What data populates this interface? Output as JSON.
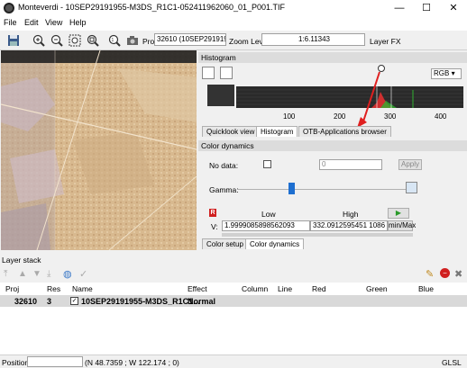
{
  "window": {
    "title": "Monteverdi - 10SEP29191955-M3DS_R1C1-052411962060_01_P001.TIF",
    "minimize": "—",
    "maximize": "☐",
    "close": "✕"
  },
  "menu": [
    "File",
    "Edit",
    "View",
    "Help"
  ],
  "toolbar": {
    "proj_label": "Proj",
    "proj_value": "32610 (10SEP291919",
    "zoom_label": "Zoom Level",
    "zoom_value": "1:6.11343",
    "layerfx_label": "Layer FX"
  },
  "histogram": {
    "title": "Histogram",
    "mode": "RGB",
    "ticks": [
      "100",
      "200",
      "300",
      "400"
    ],
    "colors": {
      "red": "#e03030",
      "green": "#30b030",
      "blue": "#3050e0"
    }
  },
  "right_tabs": [
    "Quicklook view",
    "Histogram",
    "OTB-Applications browser"
  ],
  "color_dynamics": {
    "title": "Color dynamics",
    "nodata_label": "No data:",
    "nodata_value": "0",
    "apply_label": "Apply",
    "gamma_label": "Gamma:",
    "channel_badge": "R",
    "low_label": "Low",
    "high_label": "High",
    "v_label": "V:",
    "low_value": "1.9999085898562093",
    "high_value": "332.0912595451 1086",
    "minmax_label": "min/Max"
  },
  "bottom_tabs": [
    "Color setup",
    "Color dynamics"
  ],
  "layer_stack": {
    "title": "Layer stack",
    "columns": [
      "Proj",
      "Res",
      "Name",
      "Effect",
      "Column",
      "Line",
      "Red",
      "Green",
      "Blue"
    ],
    "rows": [
      {
        "proj": "32610",
        "res": "3",
        "name": "10SEP29191955-M3DS_R1C1...",
        "effect": "Normal"
      }
    ]
  },
  "status": {
    "position_label": "Position",
    "coords": "(N 48.7359 ; W 122.174 ; 0)",
    "renderer": "GLSL"
  }
}
